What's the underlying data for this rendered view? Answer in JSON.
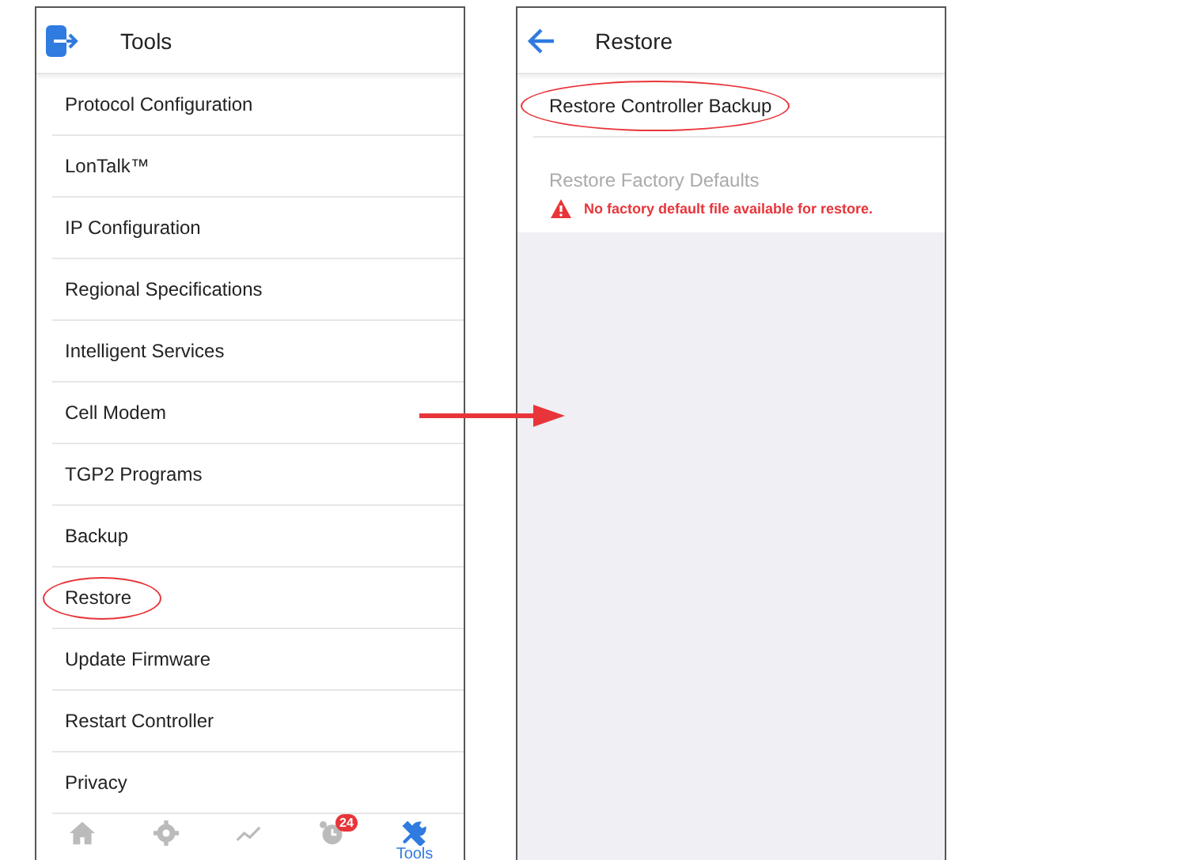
{
  "tools_screen": {
    "title": "Tools",
    "items": [
      {
        "label": "Protocol Configuration",
        "circled": false
      },
      {
        "label": "LonTalk™",
        "circled": false
      },
      {
        "label": "IP Configuration",
        "circled": false
      },
      {
        "label": "Regional Specifications",
        "circled": false
      },
      {
        "label": "Intelligent Services",
        "circled": false
      },
      {
        "label": "Cell Modem",
        "circled": false
      },
      {
        "label": "TGP2 Programs",
        "circled": false
      },
      {
        "label": "Backup",
        "circled": false
      },
      {
        "label": "Restore",
        "circled": true
      },
      {
        "label": "Update Firmware",
        "circled": false
      },
      {
        "label": "Restart Controller",
        "circled": false
      },
      {
        "label": "Privacy",
        "circled": false
      }
    ],
    "nav": [
      {
        "kind": "home",
        "selected": false
      },
      {
        "kind": "settings",
        "selected": false
      },
      {
        "kind": "trend",
        "selected": false
      },
      {
        "kind": "alarms",
        "selected": false,
        "badge": "24"
      },
      {
        "kind": "tools",
        "selected": true,
        "label": "Tools"
      }
    ]
  },
  "restore_screen": {
    "title": "Restore",
    "items": [
      {
        "label": "Restore Controller Backup",
        "disabled": false,
        "circled": true
      },
      {
        "label": "Restore Factory Defaults",
        "disabled": true,
        "circled": false,
        "warning": "No factory default file available for restore."
      }
    ]
  }
}
